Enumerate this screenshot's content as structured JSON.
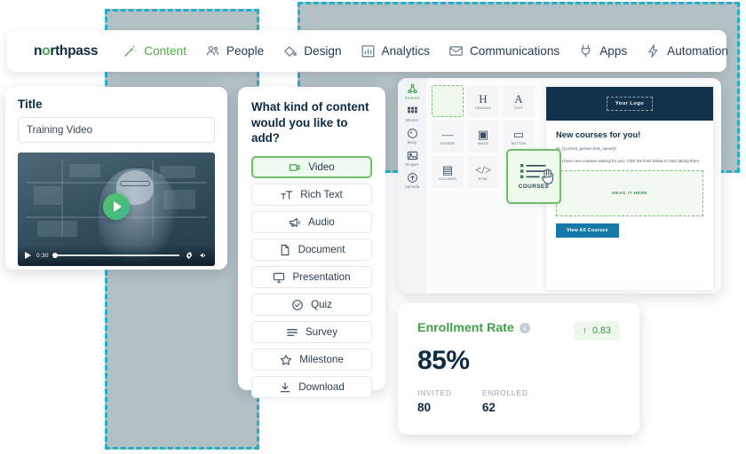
{
  "nav": {
    "logo": "northpass",
    "logo_prefix": "n",
    "logo_dot": "o",
    "logo_suffix": "rthpass",
    "menu_icon": "hamburger-icon",
    "items": [
      {
        "label": "Content",
        "icon": "magic-wand-icon",
        "active": true
      },
      {
        "label": "People",
        "icon": "people-icon",
        "active": false
      },
      {
        "label": "Design",
        "icon": "paint-bucket-icon",
        "active": false
      },
      {
        "label": "Analytics",
        "icon": "bar-chart-icon",
        "active": false
      },
      {
        "label": "Communications",
        "icon": "envelope-icon",
        "active": false
      },
      {
        "label": "Apps",
        "icon": "plug-icon",
        "active": false
      },
      {
        "label": "Automation",
        "icon": "lightning-icon",
        "active": false
      }
    ]
  },
  "video_card": {
    "label": "Title",
    "input_value": "Training Video",
    "input_placeholder": "Title",
    "player": {
      "play_icon": "play-icon",
      "time": "0:30",
      "settings_icon": "gear-icon",
      "volume_icon": "volume-icon"
    }
  },
  "content_type": {
    "title": "What kind of content would you like to add?",
    "options": [
      {
        "label": "Video",
        "icon": "video-camera-icon",
        "selected": true
      },
      {
        "label": "Rich Text",
        "icon": "text-format-icon",
        "selected": false
      },
      {
        "label": "Audio",
        "icon": "megaphone-icon",
        "selected": false
      },
      {
        "label": "Document",
        "icon": "document-icon",
        "selected": false
      },
      {
        "label": "Presentation",
        "icon": "monitor-icon",
        "selected": false
      },
      {
        "label": "Quiz",
        "icon": "check-circle-icon",
        "selected": false
      },
      {
        "label": "Survey",
        "icon": "list-lines-icon",
        "selected": false
      },
      {
        "label": "Milestone",
        "icon": "star-icon",
        "selected": false
      },
      {
        "label": "Download",
        "icon": "download-icon",
        "selected": false
      }
    ]
  },
  "email_builder": {
    "sidebar": [
      {
        "label": "Content",
        "icon": "content-nodes-icon",
        "active": true
      },
      {
        "label": "Blocks",
        "icon": "blocks-grid-icon",
        "active": false
      },
      {
        "label": "Body",
        "icon": "palette-icon",
        "active": false
      },
      {
        "label": "Images",
        "icon": "image-icon",
        "active": false
      },
      {
        "label": "Uploads",
        "icon": "upload-cloud-icon",
        "active": false
      }
    ],
    "tiles": [
      {
        "label": "",
        "glyph": "",
        "icon": "empty-drop-tile",
        "empty": true
      },
      {
        "label": "HEADING",
        "glyph": "H",
        "icon": "heading-icon",
        "empty": false
      },
      {
        "label": "TEXT",
        "glyph": "A",
        "icon": "text-icon",
        "empty": false
      },
      {
        "label": "DIVIDER",
        "glyph": "—",
        "icon": "divider-icon",
        "empty": false
      },
      {
        "label": "IMAGE",
        "glyph": "▣",
        "icon": "image-tile-icon",
        "empty": false
      },
      {
        "label": "BUTTON",
        "glyph": "▭",
        "icon": "button-icon",
        "empty": false
      },
      {
        "label": "COLUMNS",
        "glyph": "▤",
        "icon": "columns-icon",
        "empty": false
      },
      {
        "label": "HTML",
        "glyph": "</>",
        "icon": "html-code-icon",
        "empty": false
      }
    ],
    "dragged_tile": {
      "label": "COURSES",
      "icon": "courses-list-icon",
      "cursor": "hand-cursor"
    },
    "preview": {
      "logo_placeholder": "Your Logo",
      "heading": "New courses for you!",
      "greeting": "Hi, {{current_person.first_name}}!",
      "body": "You have new courses waiting for you. Click the links below to start taking them.",
      "drop_zone": "DRAG IT HERE",
      "button": "View All Courses"
    }
  },
  "enrollment": {
    "title": "Enrollment Rate",
    "info_icon": "info-icon",
    "badge": {
      "arrow": "↑",
      "value": "0.83",
      "icon": "arrow-up-icon"
    },
    "value": "85%",
    "stats": [
      {
        "label": "INVITED",
        "value": "80"
      },
      {
        "label": "ENROLLED",
        "value": "62"
      }
    ]
  },
  "colors": {
    "brand_navy": "#0d2b45",
    "brand_green": "#4ea94c",
    "accent_teal": "#22b0c9",
    "placeholder_gray": "#b3c0c4",
    "preview_blue": "#1679a8"
  }
}
